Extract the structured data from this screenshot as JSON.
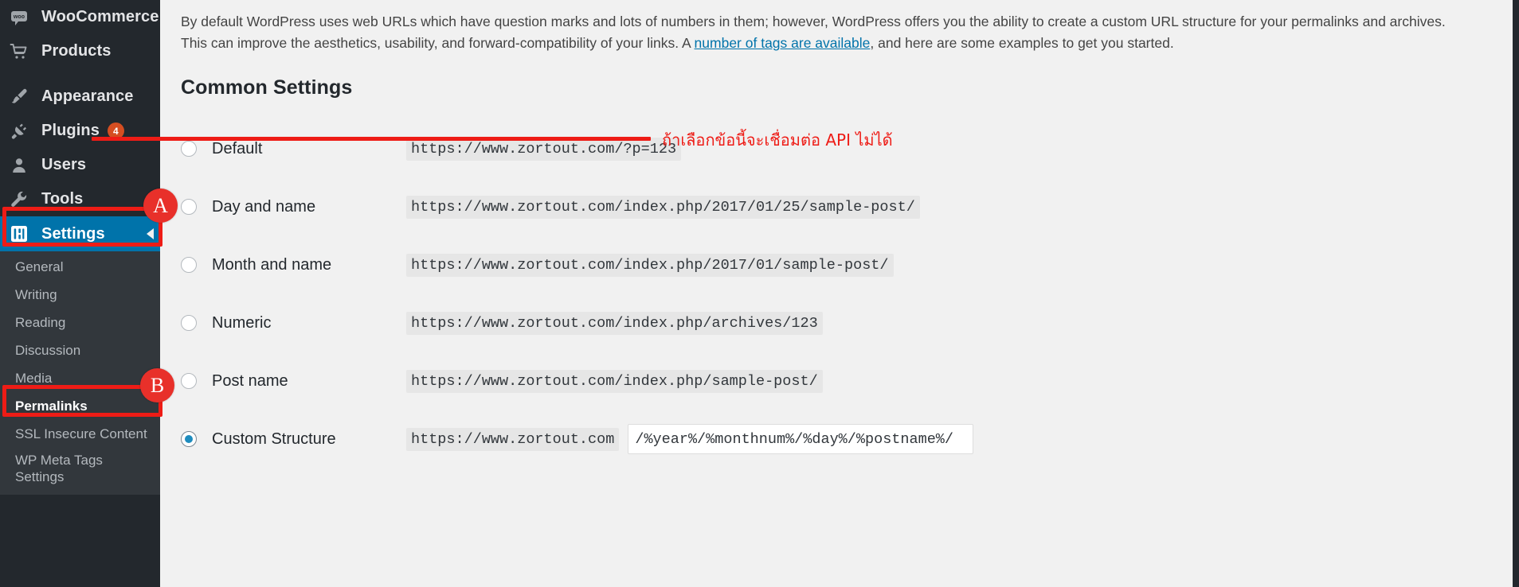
{
  "sidebar": {
    "items": [
      {
        "label": "WooCommerce",
        "icon": "woocommerce-icon",
        "badge": null
      },
      {
        "label": "Products",
        "icon": "cart-icon",
        "badge": null
      },
      {
        "label": "Appearance",
        "icon": "paintbrush-icon",
        "badge": null
      },
      {
        "label": "Plugins",
        "icon": "plug-icon",
        "badge": "4"
      },
      {
        "label": "Users",
        "icon": "user-icon",
        "badge": null
      },
      {
        "label": "Tools",
        "icon": "wrench-icon",
        "badge": null
      },
      {
        "label": "Settings",
        "icon": "settings-sliders-icon",
        "badge": null
      }
    ],
    "active_item": "Settings",
    "submenu": [
      {
        "label": "General",
        "current": false
      },
      {
        "label": "Writing",
        "current": false
      },
      {
        "label": "Reading",
        "current": false
      },
      {
        "label": "Discussion",
        "current": false
      },
      {
        "label": "Media",
        "current": false
      },
      {
        "label": "Permalinks",
        "current": true
      },
      {
        "label": "SSL Insecure Content",
        "current": false
      },
      {
        "label": "WP Meta Tags Settings",
        "current": false
      }
    ]
  },
  "main": {
    "intro_part1": "By default WordPress uses web URLs which have question marks and lots of numbers in them; however, WordPress offers you the ability to create a custom URL structure for your permalinks and archives. This can improve the aesthetics, usability, and forward-compatibility of your links. A ",
    "intro_link": "number of tags are available",
    "intro_part2": ", and here are some examples to get you started.",
    "heading": "Common Settings",
    "options": [
      {
        "label": "Default",
        "url": "https://www.zortout.com/?p=123",
        "selected": false
      },
      {
        "label": "Day and name",
        "url": "https://www.zortout.com/index.php/2017/01/25/sample-post/",
        "selected": false
      },
      {
        "label": "Month and name",
        "url": "https://www.zortout.com/index.php/2017/01/sample-post/",
        "selected": false
      },
      {
        "label": "Numeric",
        "url": "https://www.zortout.com/index.php/archives/123",
        "selected": false
      },
      {
        "label": "Post name",
        "url": "https://www.zortout.com/index.php/sample-post/",
        "selected": false
      }
    ],
    "custom": {
      "label": "Custom Structure",
      "base_url": "https://www.zortout.com",
      "value": "/%year%/%monthnum%/%day%/%postname%/"
    }
  },
  "annotations": {
    "thai_note": "ถ้าเลือกข้อนี้จะเชื่อมต่อ API ไม่ได้",
    "badge_a": "A",
    "badge_b": "B",
    "accent_red": "#ee1c16",
    "accent_blue": "#0073aa"
  }
}
